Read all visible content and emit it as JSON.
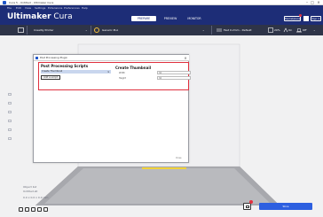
{
  "window": {
    "title": "Cura 5 - Untitled - Ultimaker Cura"
  },
  "menubar": {
    "items": [
      "File",
      "Edit",
      "View",
      "Settings",
      "Extensions",
      "Preferences",
      "Help"
    ]
  },
  "header": {
    "logo_main": "Ultimaker",
    "logo_sub": " Cura",
    "tabs": [
      "PREPARE",
      "PREVIEW",
      "MONITOR"
    ],
    "marketplace": "Marketplace",
    "signin": "Sign in"
  },
  "toolbar": {
    "printer": "Creality Printer",
    "material": "Generic PLA",
    "print_settings": "Fast 0.2mm - Default",
    "support": "20%",
    "adhesion": "On",
    "extra": "Off"
  },
  "objects": {
    "title": "Object list",
    "file": "Untitled.stl",
    "dimensions": "0.0 x 0.0 x 0.0 mm"
  },
  "bottom": {
    "slice_label": "Slice"
  },
  "dialog": {
    "title": "Post Processing Plugin",
    "pp_heading": "Post Processing Scripts",
    "script_item": "Create Thumbnail",
    "remove": "×",
    "add_script": "Add a script",
    "ct_heading": "Create Thumbnail",
    "fields": [
      {
        "label": "Width",
        "value": "32"
      },
      {
        "label": "Height",
        "value": "32"
      }
    ],
    "footer": "Close"
  },
  "colors": {
    "header": "#1d2d77",
    "toolbar": "#2e3448",
    "accent": "#2d5fe0",
    "highlight": "#e0303e"
  }
}
